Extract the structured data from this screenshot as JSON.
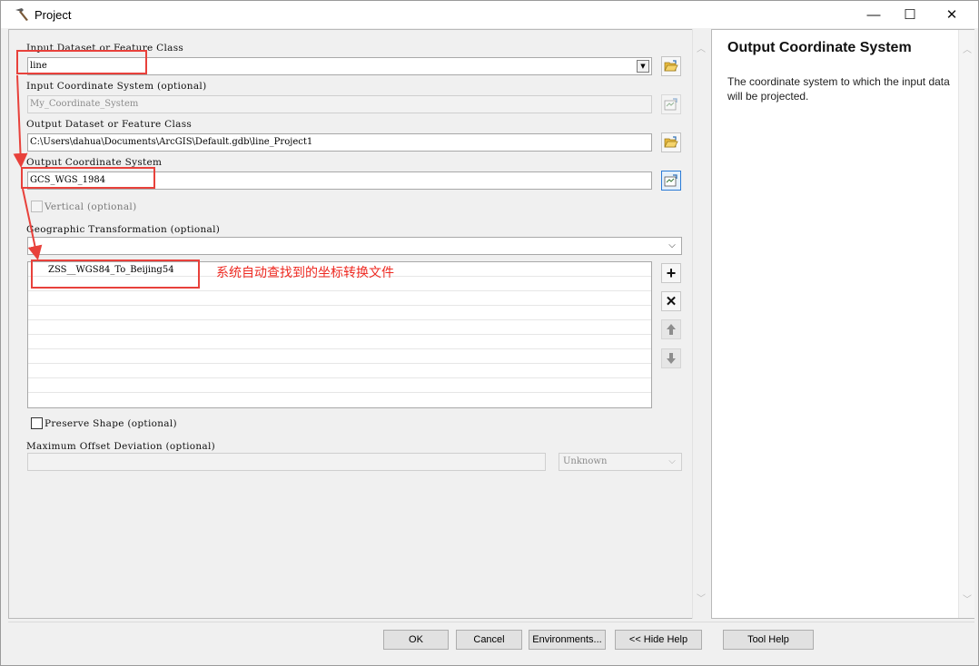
{
  "window": {
    "title": "Project",
    "minimize": "—",
    "maximize": "☐",
    "close": "✕"
  },
  "form": {
    "input_dataset_label": "Input Dataset or Feature Class",
    "input_dataset_value": "line",
    "input_coord_label": "Input Coordinate System (optional)",
    "input_coord_value": "My_Coordinate_System",
    "output_dataset_label": "Output Dataset or Feature Class",
    "output_dataset_value": "C:\\Users\\dahua\\Documents\\ArcGIS\\Default.gdb\\line_Project1",
    "output_coord_label": "Output Coordinate System",
    "output_coord_value": "GCS_WGS_1984",
    "vertical_label": "Vertical (optional)",
    "geo_trans_label": "Geographic Transformation (optional)",
    "geo_trans_value": "",
    "transformations": [
      "ZSS__WGS84_To_Beijing54"
    ],
    "preserve_shape_label": "Preserve Shape (optional)",
    "max_offset_label": "Maximum Offset Deviation (optional)",
    "max_offset_value": "",
    "offset_unit": "Unknown"
  },
  "annotation": {
    "text": "系统自动查找到的坐标转换文件",
    "color": "#ee2a22"
  },
  "help": {
    "title": "Output Coordinate System",
    "text": "The coordinate system to which the input data will be projected."
  },
  "buttons": {
    "ok": "OK",
    "cancel": "Cancel",
    "environments": "Environments...",
    "hide_help": "<< Hide Help",
    "tool_help": "Tool Help"
  },
  "icons": {
    "app": "hammer-icon",
    "browse": "folder-open-icon",
    "coord_properties": "coordinate-properties-icon",
    "add": "plus-icon",
    "remove": "x-icon",
    "up": "arrow-up-icon",
    "down": "arrow-down-icon"
  }
}
